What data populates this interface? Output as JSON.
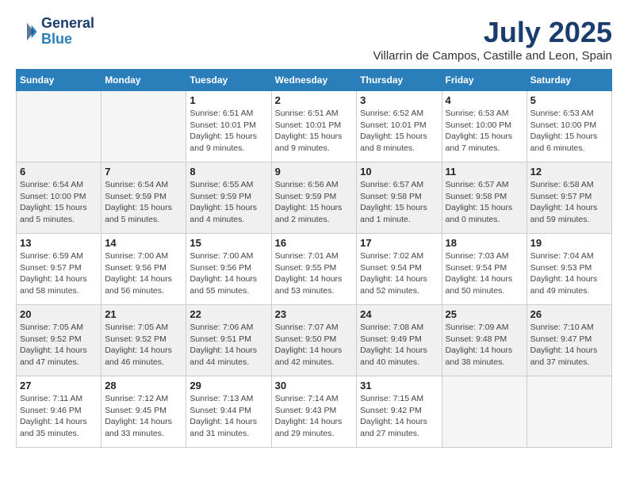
{
  "logo": {
    "line1": "General",
    "line2": "Blue"
  },
  "title": "July 2025",
  "location": "Villarrin de Campos, Castille and Leon, Spain",
  "weekdays": [
    "Sunday",
    "Monday",
    "Tuesday",
    "Wednesday",
    "Thursday",
    "Friday",
    "Saturday"
  ],
  "weeks": [
    [
      {
        "day": "",
        "info": ""
      },
      {
        "day": "",
        "info": ""
      },
      {
        "day": "1",
        "info": "Sunrise: 6:51 AM\nSunset: 10:01 PM\nDaylight: 15 hours\nand 9 minutes."
      },
      {
        "day": "2",
        "info": "Sunrise: 6:51 AM\nSunset: 10:01 PM\nDaylight: 15 hours\nand 9 minutes."
      },
      {
        "day": "3",
        "info": "Sunrise: 6:52 AM\nSunset: 10:01 PM\nDaylight: 15 hours\nand 8 minutes."
      },
      {
        "day": "4",
        "info": "Sunrise: 6:53 AM\nSunset: 10:00 PM\nDaylight: 15 hours\nand 7 minutes."
      },
      {
        "day": "5",
        "info": "Sunrise: 6:53 AM\nSunset: 10:00 PM\nDaylight: 15 hours\nand 6 minutes."
      }
    ],
    [
      {
        "day": "6",
        "info": "Sunrise: 6:54 AM\nSunset: 10:00 PM\nDaylight: 15 hours\nand 5 minutes."
      },
      {
        "day": "7",
        "info": "Sunrise: 6:54 AM\nSunset: 9:59 PM\nDaylight: 15 hours\nand 5 minutes."
      },
      {
        "day": "8",
        "info": "Sunrise: 6:55 AM\nSunset: 9:59 PM\nDaylight: 15 hours\nand 4 minutes."
      },
      {
        "day": "9",
        "info": "Sunrise: 6:56 AM\nSunset: 9:59 PM\nDaylight: 15 hours\nand 2 minutes."
      },
      {
        "day": "10",
        "info": "Sunrise: 6:57 AM\nSunset: 9:58 PM\nDaylight: 15 hours\nand 1 minute."
      },
      {
        "day": "11",
        "info": "Sunrise: 6:57 AM\nSunset: 9:58 PM\nDaylight: 15 hours\nand 0 minutes."
      },
      {
        "day": "12",
        "info": "Sunrise: 6:58 AM\nSunset: 9:57 PM\nDaylight: 14 hours\nand 59 minutes."
      }
    ],
    [
      {
        "day": "13",
        "info": "Sunrise: 6:59 AM\nSunset: 9:57 PM\nDaylight: 14 hours\nand 58 minutes."
      },
      {
        "day": "14",
        "info": "Sunrise: 7:00 AM\nSunset: 9:56 PM\nDaylight: 14 hours\nand 56 minutes."
      },
      {
        "day": "15",
        "info": "Sunrise: 7:00 AM\nSunset: 9:56 PM\nDaylight: 14 hours\nand 55 minutes."
      },
      {
        "day": "16",
        "info": "Sunrise: 7:01 AM\nSunset: 9:55 PM\nDaylight: 14 hours\nand 53 minutes."
      },
      {
        "day": "17",
        "info": "Sunrise: 7:02 AM\nSunset: 9:54 PM\nDaylight: 14 hours\nand 52 minutes."
      },
      {
        "day": "18",
        "info": "Sunrise: 7:03 AM\nSunset: 9:54 PM\nDaylight: 14 hours\nand 50 minutes."
      },
      {
        "day": "19",
        "info": "Sunrise: 7:04 AM\nSunset: 9:53 PM\nDaylight: 14 hours\nand 49 minutes."
      }
    ],
    [
      {
        "day": "20",
        "info": "Sunrise: 7:05 AM\nSunset: 9:52 PM\nDaylight: 14 hours\nand 47 minutes."
      },
      {
        "day": "21",
        "info": "Sunrise: 7:05 AM\nSunset: 9:52 PM\nDaylight: 14 hours\nand 46 minutes."
      },
      {
        "day": "22",
        "info": "Sunrise: 7:06 AM\nSunset: 9:51 PM\nDaylight: 14 hours\nand 44 minutes."
      },
      {
        "day": "23",
        "info": "Sunrise: 7:07 AM\nSunset: 9:50 PM\nDaylight: 14 hours\nand 42 minutes."
      },
      {
        "day": "24",
        "info": "Sunrise: 7:08 AM\nSunset: 9:49 PM\nDaylight: 14 hours\nand 40 minutes."
      },
      {
        "day": "25",
        "info": "Sunrise: 7:09 AM\nSunset: 9:48 PM\nDaylight: 14 hours\nand 38 minutes."
      },
      {
        "day": "26",
        "info": "Sunrise: 7:10 AM\nSunset: 9:47 PM\nDaylight: 14 hours\nand 37 minutes."
      }
    ],
    [
      {
        "day": "27",
        "info": "Sunrise: 7:11 AM\nSunset: 9:46 PM\nDaylight: 14 hours\nand 35 minutes."
      },
      {
        "day": "28",
        "info": "Sunrise: 7:12 AM\nSunset: 9:45 PM\nDaylight: 14 hours\nand 33 minutes."
      },
      {
        "day": "29",
        "info": "Sunrise: 7:13 AM\nSunset: 9:44 PM\nDaylight: 14 hours\nand 31 minutes."
      },
      {
        "day": "30",
        "info": "Sunrise: 7:14 AM\nSunset: 9:43 PM\nDaylight: 14 hours\nand 29 minutes."
      },
      {
        "day": "31",
        "info": "Sunrise: 7:15 AM\nSunset: 9:42 PM\nDaylight: 14 hours\nand 27 minutes."
      },
      {
        "day": "",
        "info": ""
      },
      {
        "day": "",
        "info": ""
      }
    ]
  ]
}
